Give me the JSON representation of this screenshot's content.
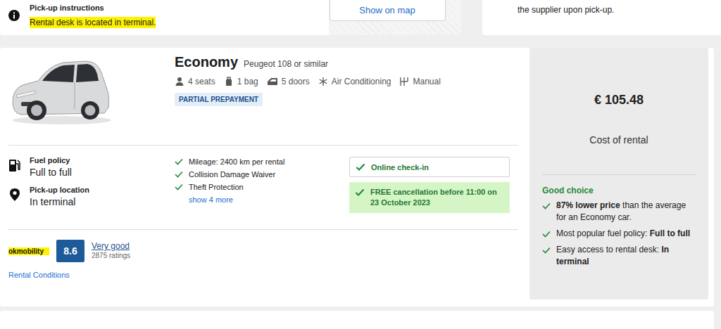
{
  "pickup": {
    "heading": "Pick-up instructions",
    "text": "Rental desk is located in terminal.",
    "highlighted": true,
    "map_button": "Show on map"
  },
  "side_note": {
    "text": "the supplier upon pick-up."
  },
  "offer": {
    "category": "Economy",
    "model": "Peugeot 108 or similar",
    "features": [
      {
        "kind": "seats",
        "label": "4 seats"
      },
      {
        "kind": "bag",
        "label": "1 bag"
      },
      {
        "kind": "doors",
        "label": "5 doors"
      },
      {
        "kind": "ac",
        "label": "Air Conditioning"
      },
      {
        "kind": "gear",
        "label": "Manual"
      }
    ],
    "badge": "PARTIAL PREPAYMENT",
    "details": [
      {
        "kind": "fuel",
        "label": "Fuel policy",
        "value": "Full to full"
      },
      {
        "kind": "pin",
        "label": "Pick-up location",
        "value": "In terminal"
      }
    ],
    "inclusions": [
      "Mileage: 2400 km per rental",
      "Collision Damage Waiver",
      "Theft Protection"
    ],
    "more_link": "show 4 more",
    "checkin": "Online check-in",
    "cancellation": "FREE cancellation before 11:00 on 23 October 2023",
    "supplier": {
      "name": "okmobility",
      "highlighted": true,
      "score": "8.6",
      "rating_label": "Very good",
      "ratings_count": "2875 ratings"
    },
    "conditions_link": "Rental Conditions"
  },
  "price": {
    "amount": "€ 105.48",
    "label": "Cost of rental",
    "verdict": "Good choice",
    "reasons": [
      [
        {
          "text": "87% lower price",
          "bold": true
        },
        {
          "text": " than the average for an Economy car.",
          "bold": false
        }
      ],
      [
        {
          "text": "Most popular fuel policy: ",
          "bold": false
        },
        {
          "text": "Full to full",
          "bold": true
        }
      ],
      [
        {
          "text": "Easy access to rental desk: ",
          "bold": false
        },
        {
          "text": "In terminal",
          "bold": true
        }
      ]
    ]
  }
}
